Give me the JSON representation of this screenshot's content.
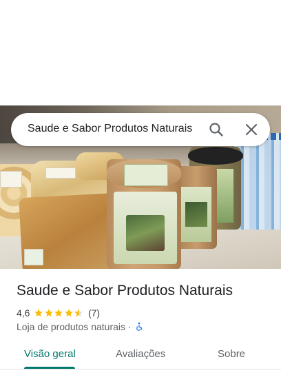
{
  "search": {
    "query": "Saude e Sabor Produtos Naturais",
    "search_icon": "search-icon",
    "close_icon": "close-icon"
  },
  "place": {
    "name": "Saude e Sabor Produtos Naturais",
    "rating": "4,6",
    "rating_value": 4.6,
    "stars_max": 5,
    "review_count": "(7)",
    "category": "Loja de produtos naturais",
    "separator": "·",
    "accessibility_icon": "wheelchair-icon"
  },
  "tabs": [
    {
      "label": "Visão geral",
      "selected": true
    },
    {
      "label": "Avaliações",
      "selected": false
    },
    {
      "label": "Sobre",
      "selected": false
    }
  ],
  "colors": {
    "accent": "#00796b",
    "star": "#fbbc04",
    "accessibility": "#1a73e8"
  }
}
